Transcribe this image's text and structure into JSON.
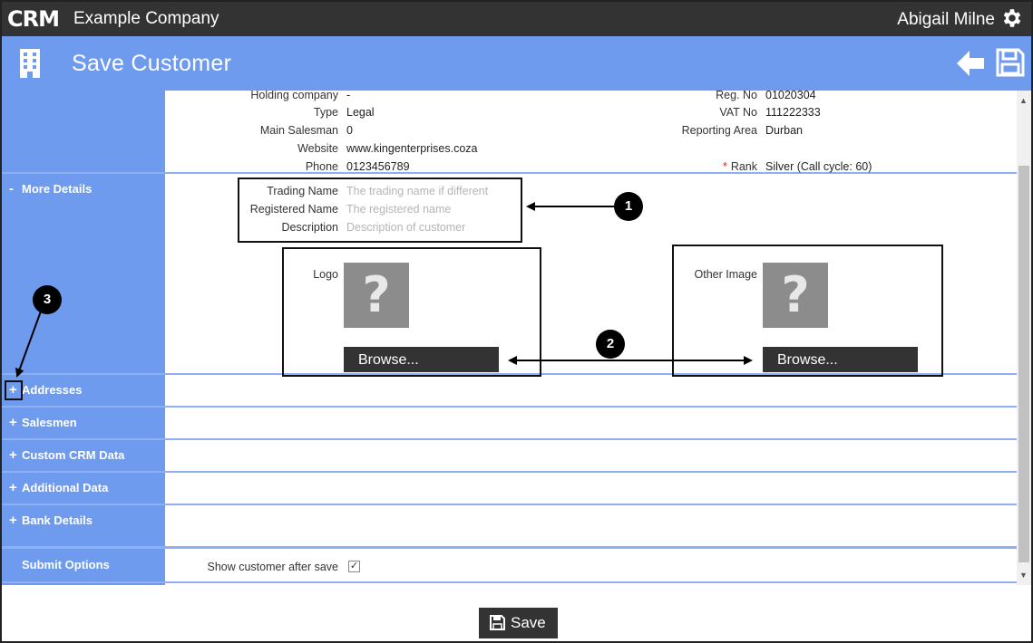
{
  "app": {
    "logo": "CRM",
    "company": "Example Company",
    "user": "Abigail Milne"
  },
  "header": {
    "title": "Save Customer"
  },
  "summary_fields": {
    "left": [
      {
        "label": "Holding company",
        "value": "-"
      },
      {
        "label": "Type",
        "value": "Legal"
      },
      {
        "label": "Main Salesman",
        "value": "0"
      },
      {
        "label": "Website",
        "value": "www.kingenterprises.coza"
      },
      {
        "label": "Phone",
        "value": "0123456789"
      }
    ],
    "right": [
      {
        "label": "Reg. No",
        "value": "01020304"
      },
      {
        "label": "VAT No",
        "value": "111222333"
      },
      {
        "label": "Reporting Area",
        "value": "Durban"
      },
      {
        "label": "Rank",
        "value": "Silver (Call cycle: 60)",
        "required_marker": "*"
      }
    ]
  },
  "more_details": {
    "toggle": "-",
    "label": "More Details",
    "fields": [
      {
        "label": "Trading Name",
        "placeholder": "The trading name if different"
      },
      {
        "label": "Registered Name",
        "placeholder": "The registered name"
      },
      {
        "label": "Description",
        "placeholder": "Description of customer"
      }
    ],
    "logo_label": "Logo",
    "other_image_label": "Other Image",
    "image_placeholder": "?",
    "browse_label": "Browse..."
  },
  "sections": [
    {
      "toggle": "+",
      "label": "Addresses"
    },
    {
      "toggle": "+",
      "label": "Salesmen"
    },
    {
      "toggle": "+",
      "label": "Custom CRM Data"
    },
    {
      "toggle": "+",
      "label": "Additional Data"
    },
    {
      "toggle": "+",
      "label": "Bank Details"
    }
  ],
  "submit_options": {
    "label": "Submit Options",
    "checkbox_label": "Show customer after save",
    "checkbox_checked": true,
    "check_glyph": "✓"
  },
  "footer": {
    "save_label": "Save"
  },
  "callouts": [
    "1",
    "2",
    "3"
  ],
  "colors": {
    "topbar": "#333333",
    "accent": "#6f9bef",
    "divider": "#8fb0f0",
    "required": "#e02020"
  }
}
